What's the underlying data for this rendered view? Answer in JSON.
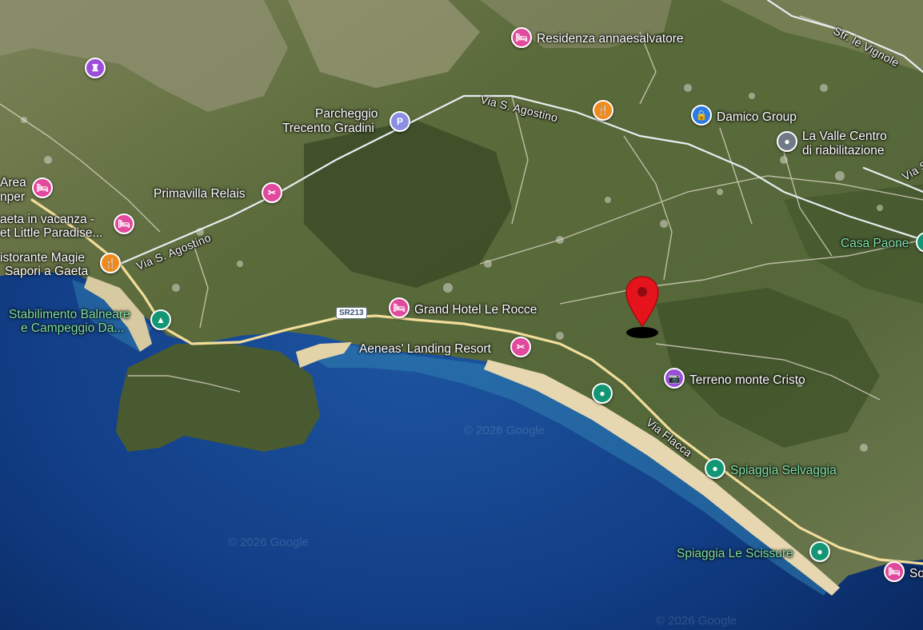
{
  "map": {
    "colors": {
      "sea_deep": "#0c2f6a",
      "sea_shallow": "#2a7ab0",
      "land": "#5f6e3e",
      "beach": "#e6d7b0",
      "road": "#f4dfa0",
      "pin": "#e5131c"
    },
    "road_labels": {
      "via_s_agostino_top": "Via S. Agostino",
      "via_s_agostino_left": "Via S. Agostino",
      "via_flacca": "Via Flacca",
      "str_le_vignole": "Str. le Vignole",
      "via_s_right": "Via S",
      "sr213": "SR213"
    },
    "poi": {
      "residenza": "Residenza annaesalvatore",
      "parcheggio_line1": "Parcheggio",
      "parcheggio_line2": "Trecento Gradini",
      "damico": "Damico Group",
      "lavalle_line1": "La Valle Centro",
      "lavalle_line2": "di riabilitazione",
      "primavilla": "Primavilla Relais",
      "area_line1": "Area",
      "area_line2": "nper",
      "gaeta_line1": "aeta in vacanza -",
      "gaeta_line2": "et Little Paradise...",
      "ristorante_line1": "istorante Magie",
      "ristorante_line2": "Sapori a Gaeta",
      "stabilimento_line1": "Stabilimento Balneare",
      "stabilimento_line2": "e Campeggio Da...",
      "grand_hotel": "Grand Hotel Le Rocce",
      "aeneas": "Aeneas' Landing Resort",
      "terreno": "Terreno monte Cristo",
      "casa_paone": "Casa Paone",
      "selvaggia": "Spiaggia Selvaggia",
      "scissure": "Spiaggia Le Scissure",
      "so": "So"
    },
    "icons": {
      "hotel": "🛏",
      "restaurant": "🍴",
      "parking": "P",
      "shop": "🔒",
      "place": "●",
      "camping": "▲",
      "resort": "✂",
      "photo": "📷",
      "castle": "♜"
    },
    "watermarks": [
      "© 2026 Google",
      "© 2026 Google",
      "© 2026 Google"
    ]
  }
}
